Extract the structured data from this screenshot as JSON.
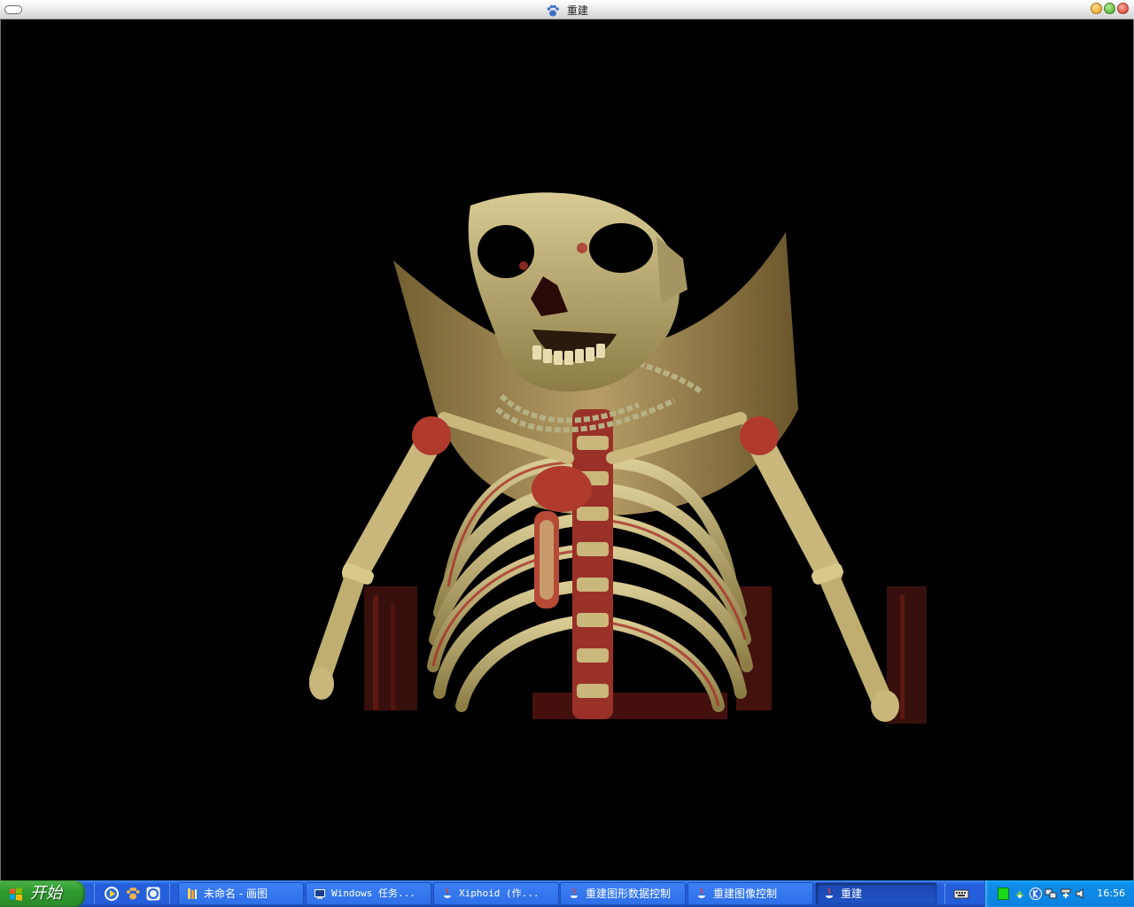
{
  "window": {
    "title": "重建"
  },
  "taskbar": {
    "start_label": "开始",
    "tasks": [
      {
        "label": "未命名 - 画图"
      },
      {
        "label": "Windows 任务..."
      },
      {
        "label": "Xiphoid (作..."
      },
      {
        "label": "重建图形数据控制"
      },
      {
        "label": "重建图像控制"
      },
      {
        "label": "重建"
      }
    ],
    "active_task_index": 5,
    "clock": "16:56"
  },
  "colors": {
    "background": "#000000",
    "bone": "#c7b77a",
    "tissue": "#a8322a",
    "taskbar": "#245edb"
  }
}
